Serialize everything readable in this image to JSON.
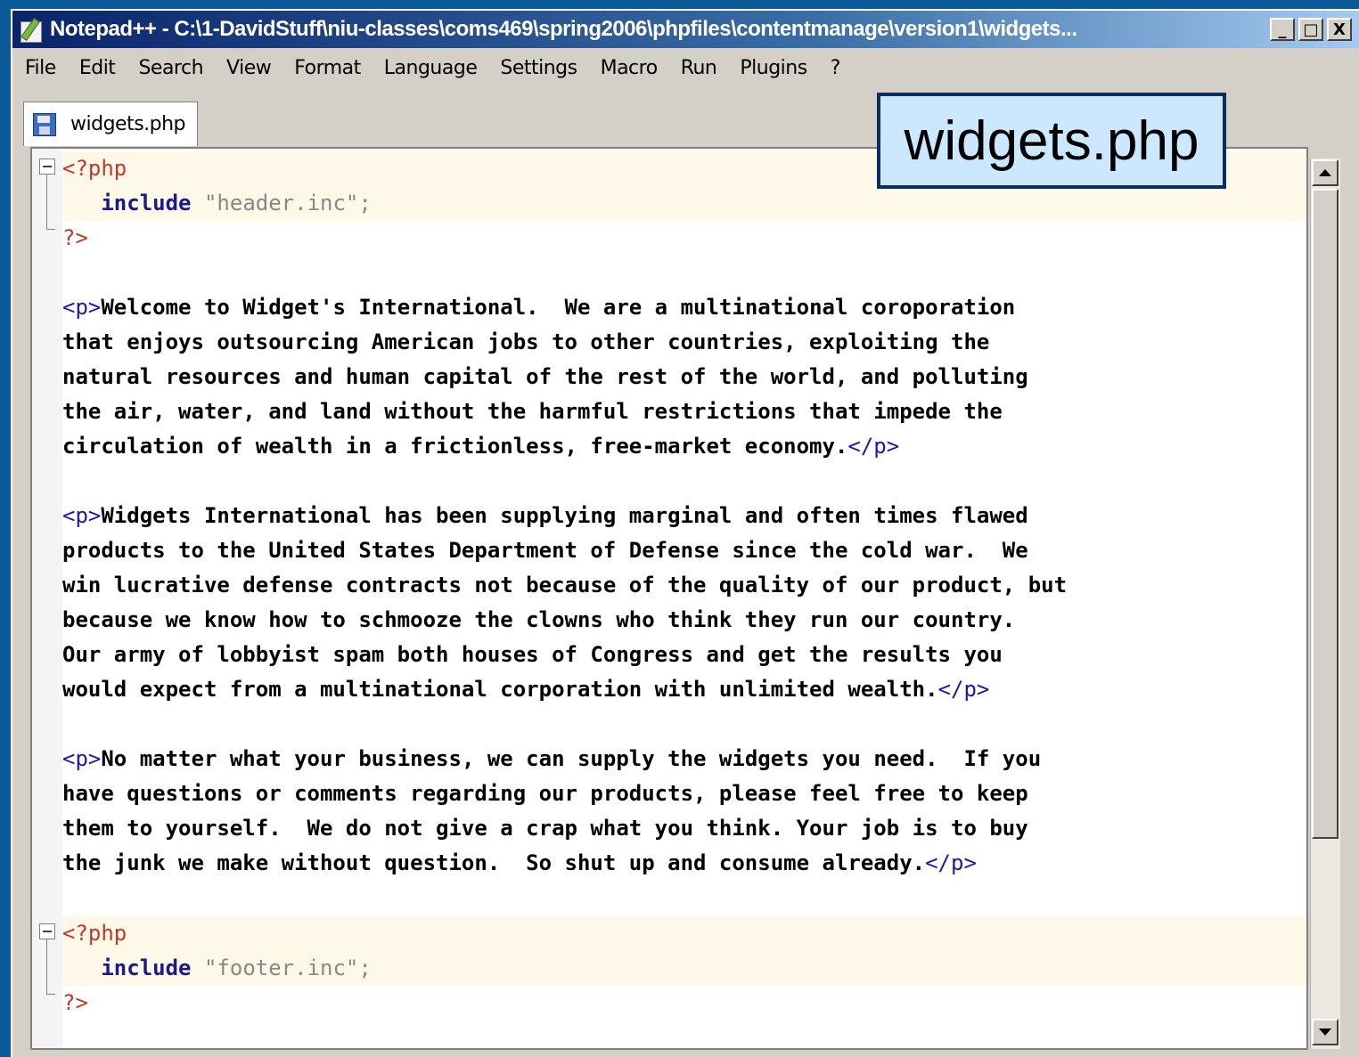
{
  "window": {
    "title": "Notepad++ - C:\\1-DavidStuff\\niu-classes\\coms469\\spring2006\\phpfiles\\contentmanage\\version1\\widgets...",
    "minimize_label": "_",
    "maximize_label": "□",
    "close_label": "X"
  },
  "menu": {
    "file": "File",
    "edit": "Edit",
    "search": "Search",
    "view": "View",
    "format": "Format",
    "language": "Language",
    "settings": "Settings",
    "macro": "Macro",
    "run": "Run",
    "plugins": "Plugins",
    "help": "?"
  },
  "tab": {
    "label": "widgets.php",
    "icon": "save-icon"
  },
  "callout": {
    "text": "widgets.php"
  },
  "code": {
    "l1_open": "<?php",
    "l2_kw": "include",
    "l2_str": "\"header.inc\";",
    "l3_close": "?>",
    "p_open": "<p>",
    "p_close": "</p>",
    "p1_l1": "Welcome to Widget's International.  We are a multinational coroporation",
    "p1_l2": "that enjoys outsourcing American jobs to other countries, exploiting the",
    "p1_l3": "natural resources and human capital of the rest of the world, and polluting",
    "p1_l4": "the air, water, and land without the harmful restrictions that impede the",
    "p1_l5": "circulation of wealth in a frictionless, free-market economy.",
    "p2_l1": "Widgets International has been supplying marginal and often times flawed",
    "p2_l2": "products to the United States Department of Defense since the cold war.  We",
    "p2_l3": "win lucrative defense contracts not because of the quality of our product, but",
    "p2_l4": "because we know how to schmooze the clowns who think they run our country.",
    "p2_l5": "Our army of lobbyist spam both houses of Congress and get the results you",
    "p2_l6": "would expect from a multinational corporation with unlimited wealth.",
    "p3_l1": "No matter what your business, we can supply the widgets you need.  If you",
    "p3_l2": "have questions or comments regarding our products, please feel free to keep",
    "p3_l3": "them to yourself.  We do not give a crap what you think. Your job is to buy",
    "p3_l4": "the junk we make without question.  So shut up and consume already.",
    "f1_open": "<?php",
    "f2_kw": "include",
    "f2_str": "\"footer.inc\";",
    "f3_close": "?>"
  }
}
